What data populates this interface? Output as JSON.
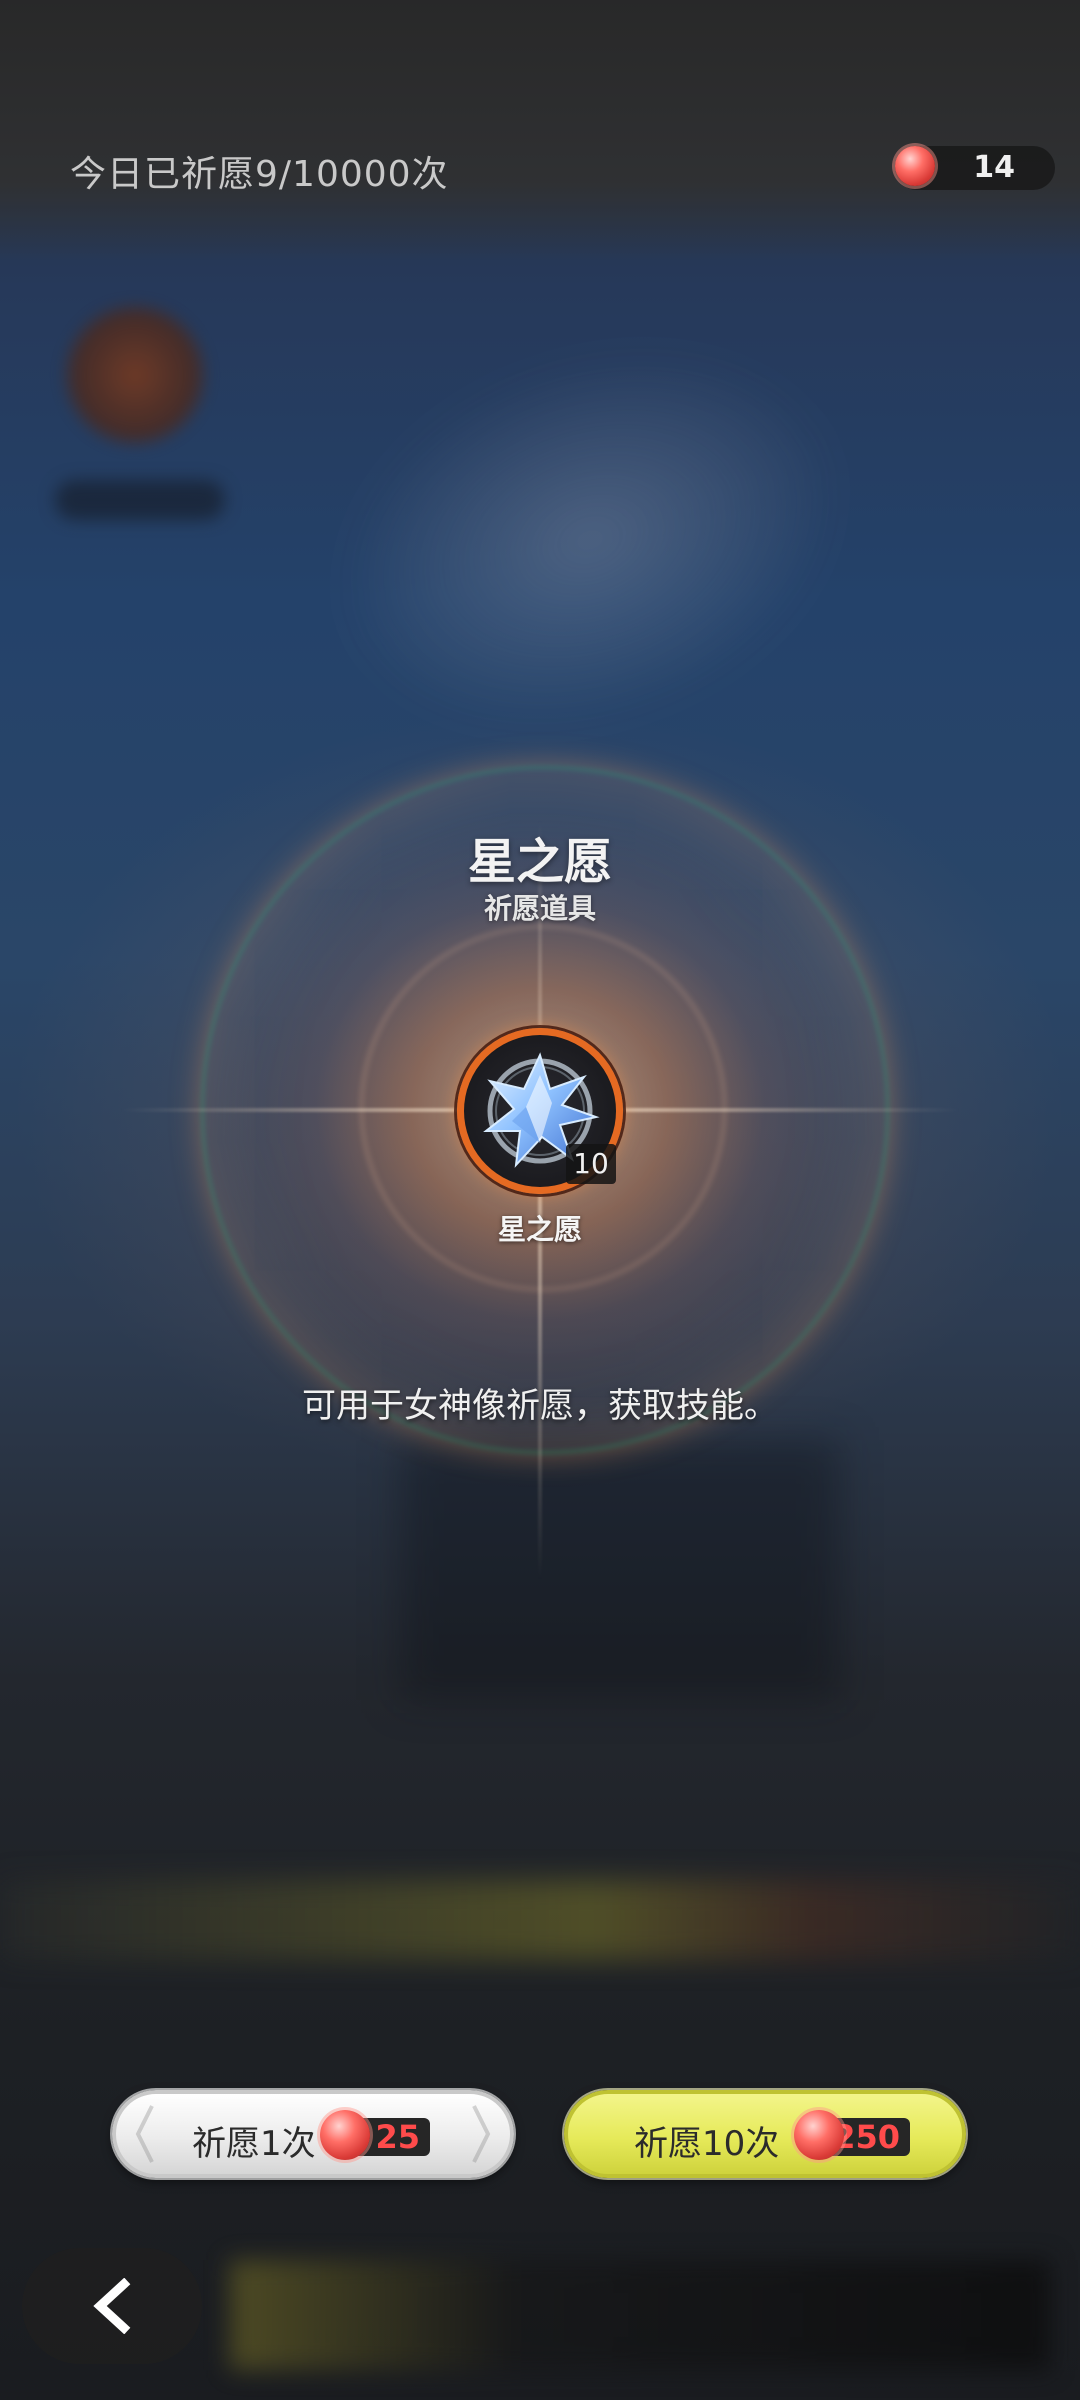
{
  "header": {
    "prayer_count_text": "今日已祈愿9/10000次",
    "currency": {
      "icon": "red-gem-icon",
      "value": "14"
    }
  },
  "item": {
    "title": "星之愿",
    "category": "祈愿道具",
    "icon": "star-crystal-icon",
    "quantity": "10",
    "name": "星之愿",
    "description": "可用于女神像祈愿，获取技能。"
  },
  "actions": {
    "pray_once": {
      "label": "祈愿1次",
      "cost": "25",
      "cost_icon": "red-gem-icon"
    },
    "pray_ten": {
      "label": "祈愿10次",
      "cost": "250",
      "cost_icon": "red-gem-icon"
    },
    "back_icon": "chevron-left-icon"
  },
  "colors": {
    "item_frame": "#e56a22",
    "pray_ten_button": "#e6ea5a",
    "pray_once_button": "#ececec",
    "cost_text": "#ff4b4b"
  }
}
